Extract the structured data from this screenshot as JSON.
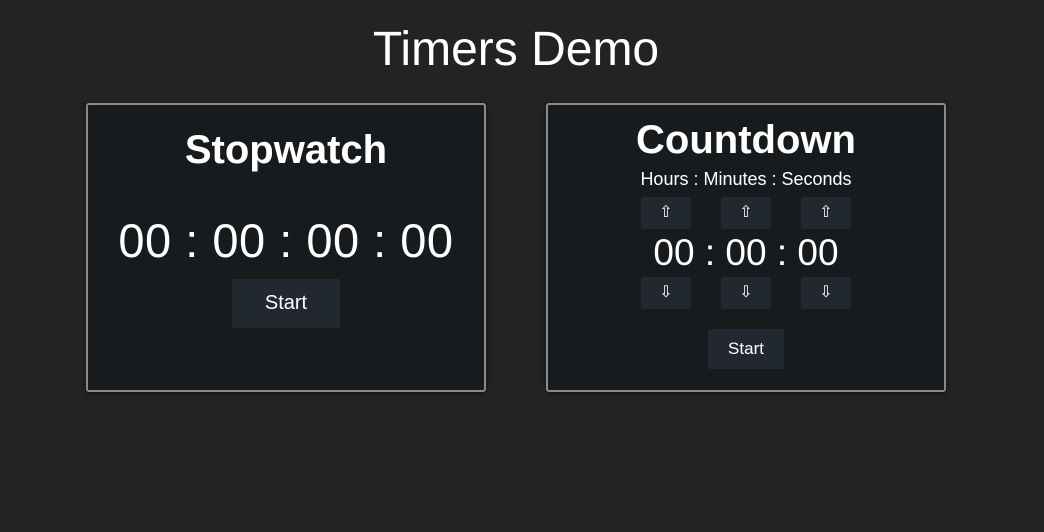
{
  "page": {
    "title": "Timers Demo"
  },
  "stopwatch": {
    "title": "Stopwatch",
    "display": "00 : 00 : 00 : 00",
    "start_label": "Start"
  },
  "countdown": {
    "title": "Countdown",
    "subtitle": "Hours : Minutes : Seconds",
    "display": "00 : 00 : 00",
    "up_arrow": "⇧",
    "down_arrow": "⇩",
    "start_label": "Start"
  }
}
